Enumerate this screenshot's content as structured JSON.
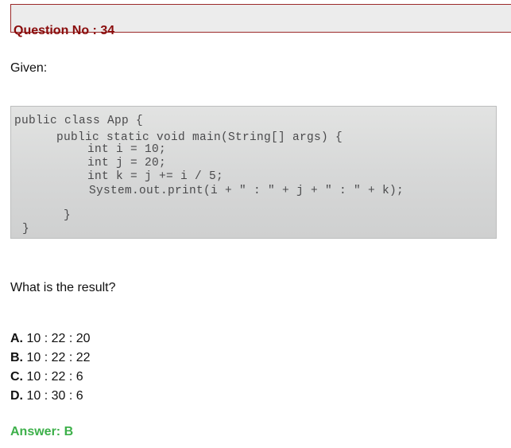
{
  "question": {
    "title": "Question No : 34",
    "given_label": "Given:",
    "code_lines": [
      "public class App {",
      "public static void main(String[] args) {",
      "int i = 10;",
      "int j = 20;",
      "int k = j += i / 5;",
      "System.out.print(i + \" : \" + j + \" : \" + k);",
      "}",
      "}"
    ],
    "prompt": "What is the result?",
    "options": [
      {
        "letter": "A.",
        "text": "10 : 22 : 20"
      },
      {
        "letter": "B.",
        "text": "10 : 22 : 22"
      },
      {
        "letter": "C.",
        "text": "10 : 22 : 6"
      },
      {
        "letter": "D.",
        "text": "10 : 30 : 6"
      }
    ],
    "answer": "Answer: B"
  },
  "colors": {
    "title": "#8a0c0c",
    "header_border": "#9b2a2a",
    "header_bg": "#ececec",
    "answer": "#3db04a"
  }
}
